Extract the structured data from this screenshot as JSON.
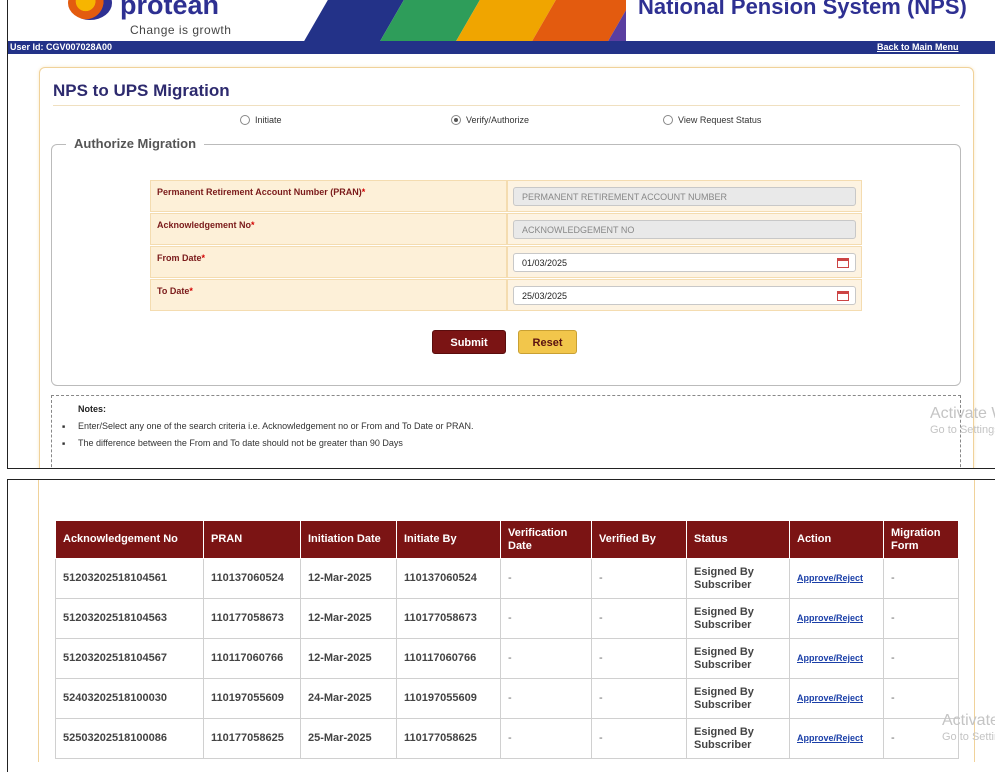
{
  "header": {
    "logo_text": "protean",
    "tagline": "Change is growth",
    "system_title": "National Pension System (NPS)",
    "user_id": "User Id: CGV007028A00",
    "back_link": "Back to Main Menu",
    "stripe_colors": [
      "#233288",
      "#2e9d5a",
      "#f0a500",
      "#e35b0f",
      "#5a3ea0"
    ]
  },
  "page": {
    "title": "NPS to UPS Migration",
    "radios": [
      {
        "label": "Initiate",
        "selected": false
      },
      {
        "label": "Verify/Authorize",
        "selected": true
      },
      {
        "label": "View Request Status",
        "selected": false
      }
    ]
  },
  "form": {
    "legend": "Authorize Migration",
    "fields": [
      {
        "label": "Permanent Retirement Account Number (PRAN)",
        "required": "*",
        "value": "",
        "placeholder": "PERMANENT RETIREMENT ACCOUNT NUMBER"
      },
      {
        "label": "Acknowledgement No",
        "required": "*",
        "value": "",
        "placeholder": "ACKNOWLEDGEMENT NO"
      },
      {
        "label": "From Date",
        "required": "*",
        "value": "01/03/2025",
        "placeholder": ""
      },
      {
        "label": "To Date",
        "required": "*",
        "value": "25/03/2025",
        "placeholder": ""
      }
    ],
    "submit_label": "Submit",
    "reset_label": "Reset"
  },
  "notes": {
    "title": "Notes:",
    "items": [
      "Enter/Select any one of the search criteria i.e. Acknowledgement no or From and To Date or PRAN.",
      "The difference between the From and To date should not be greater than 90 Days"
    ]
  },
  "watermark": {
    "line1": "Activate Windows",
    "line2": "Go to Settings to activate Windows."
  },
  "table": {
    "columns": [
      "Acknowledgement No",
      "PRAN",
      "Initiation Date",
      "Initiate By",
      "Verification Date",
      "Verified By",
      "Status",
      "Action",
      "Migration Form"
    ],
    "rows": [
      {
        "ack": "51203202518104561",
        "pran": "110137060524",
        "init_date": "12-Mar-2025",
        "init_by": "110137060524",
        "ver_date": "-",
        "ver_by": "-",
        "status": "Esigned By Subscriber",
        "action": "Approve/Reject",
        "form": "-"
      },
      {
        "ack": "51203202518104563",
        "pran": "110177058673",
        "init_date": "12-Mar-2025",
        "init_by": "110177058673",
        "ver_date": "-",
        "ver_by": "-",
        "status": "Esigned By Subscriber",
        "action": "Approve/Reject",
        "form": "-"
      },
      {
        "ack": "51203202518104567",
        "pran": "110117060766",
        "init_date": "12-Mar-2025",
        "init_by": "110117060766",
        "ver_date": "-",
        "ver_by": "-",
        "status": "Esigned By Subscriber",
        "action": "Approve/Reject",
        "form": "-"
      },
      {
        "ack": "52403202518100030",
        "pran": "110197055609",
        "init_date": "24-Mar-2025",
        "init_by": "110197055609",
        "ver_date": "-",
        "ver_by": "-",
        "status": "Esigned By Subscriber",
        "action": "Approve/Reject",
        "form": "-"
      },
      {
        "ack": "52503202518100086",
        "pran": "110177058625",
        "init_date": "25-Mar-2025",
        "init_by": "110177058625",
        "ver_date": "-",
        "ver_by": "-",
        "status": "Esigned By Subscriber",
        "action": "Approve/Reject",
        "form": "-"
      }
    ]
  }
}
